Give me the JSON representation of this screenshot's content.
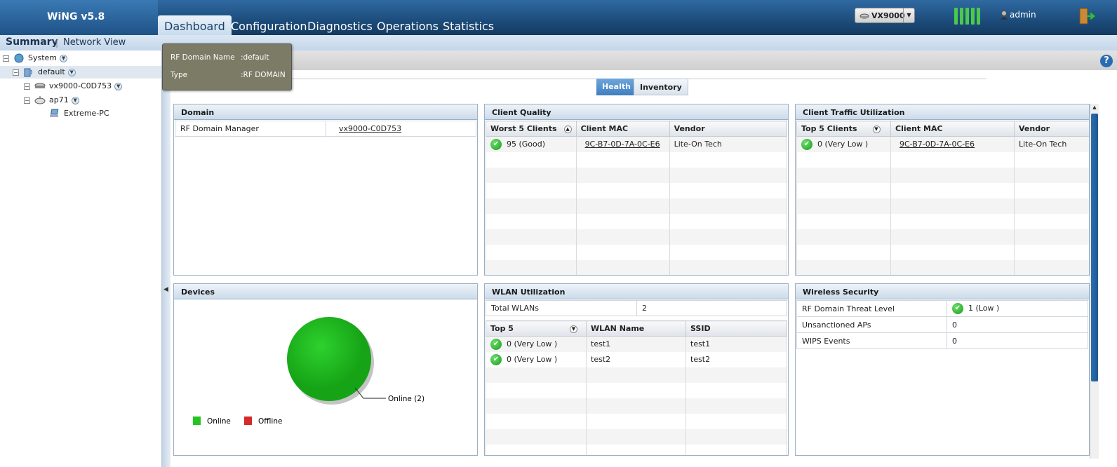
{
  "app": {
    "title": "WiNG v5.8"
  },
  "nav": {
    "tabs": [
      {
        "label": "Dashboard"
      },
      {
        "label": "Configuration"
      },
      {
        "label": "Diagnostics"
      },
      {
        "label": "Operations"
      },
      {
        "label": "Statistics"
      }
    ]
  },
  "device_selector": {
    "value": "VX9000"
  },
  "user": {
    "name": "admin"
  },
  "subnav": {
    "summary": "Summary",
    "separator": "|",
    "network_view": "Network View"
  },
  "tree": {
    "items": [
      {
        "label": "System"
      },
      {
        "label": "default"
      },
      {
        "label": "vx9000-C0D753"
      },
      {
        "label": "ap71"
      },
      {
        "label": "Extreme-PC"
      }
    ]
  },
  "tooltip": {
    "row1_key": "RF Domain Name",
    "row1_val": ":default",
    "row2_key": "Type",
    "row2_val": ":RF DOMAIN"
  },
  "tabs": {
    "health": "Health",
    "inventory": "Inventory"
  },
  "domain": {
    "title": "Domain",
    "manager_label": "RF Domain Manager",
    "manager_value": "vx9000-C0D753"
  },
  "client_quality": {
    "title": "Client Quality",
    "headers": [
      "Worst 5 Clients",
      "Client MAC",
      "Vendor"
    ],
    "rows": [
      {
        "score": "95 (Good)",
        "mac": "9C-B7-0D-7A-0C-E6",
        "vendor": "Lite-On Tech"
      }
    ]
  },
  "client_traffic": {
    "title": "Client Traffic Utilization",
    "headers": [
      "Top 5 Clients",
      "Client MAC",
      "Vendor"
    ],
    "rows": [
      {
        "score": "0 (Very Low )",
        "mac": "9C-B7-0D-7A-0C-E6",
        "vendor": "Lite-On Tech"
      }
    ]
  },
  "devices": {
    "title": "Devices",
    "pie_label": "Online (2)",
    "legend": [
      {
        "label": "Online",
        "color": "#22c422"
      },
      {
        "label": "Offline",
        "color": "#d42a2a"
      }
    ],
    "online": 2,
    "offline": 0
  },
  "wlan": {
    "title": "WLAN Utilization",
    "total_label": "Total WLANs",
    "total_value": "2",
    "headers": [
      "Top 5",
      "WLAN Name",
      "SSID"
    ],
    "rows": [
      {
        "score": "0 (Very Low )",
        "name": "test1",
        "ssid": "test1"
      },
      {
        "score": "0 (Very Low )",
        "name": "test2",
        "ssid": "test2"
      }
    ]
  },
  "security": {
    "title": "Wireless Security",
    "rows": [
      {
        "label": "RF Domain Threat Level",
        "value": "1 (Low )"
      },
      {
        "label": "Unsanctioned APs",
        "value": "0"
      },
      {
        "label": "WIPS Events",
        "value": "0"
      }
    ]
  },
  "colors": {
    "accent": "#3f7ec0",
    "ok": "#179a17",
    "topbar": "#1c4c7b"
  }
}
